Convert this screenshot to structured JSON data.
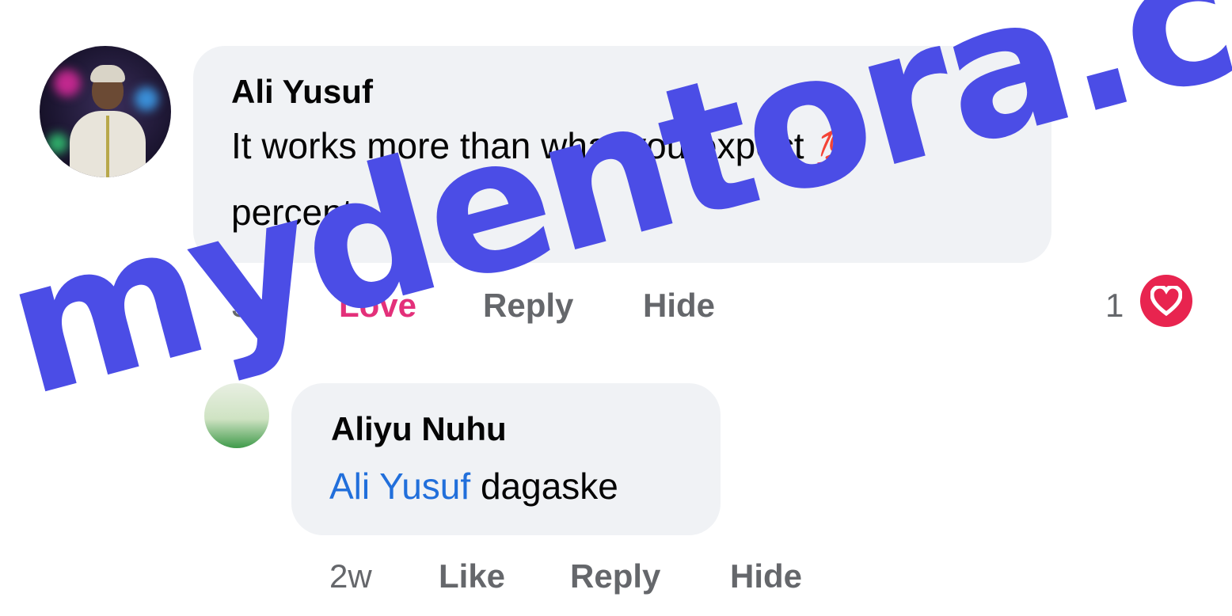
{
  "comment": {
    "author": "Ali Yusuf",
    "text_line1": "It works more than what you expect",
    "emoji": "💯",
    "text_line2": "percent",
    "time": "3w",
    "love_label": "Love",
    "reply_label": "Reply",
    "hide_label": "Hide",
    "reaction_count": "1",
    "reaction_icon": "heart-icon",
    "love_color": "#e3307a"
  },
  "reply": {
    "author": "Aliyu Nuhu",
    "mention": "Ali Yusuf",
    "text": "dagaske",
    "time": "2w",
    "like_label": "Like",
    "reply_label": "Reply",
    "hide_label": "Hide",
    "mention_color": "#216fdb"
  },
  "watermark": {
    "text": "mydentora.com",
    "color": "#4b4de6"
  }
}
